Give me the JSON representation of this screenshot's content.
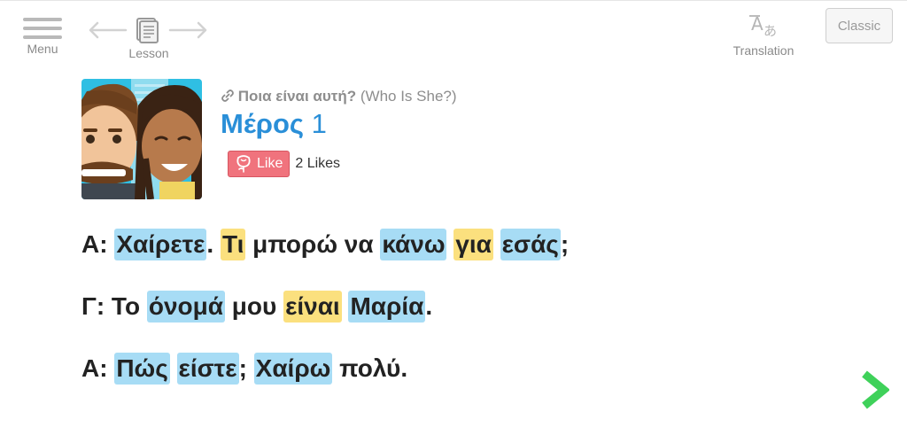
{
  "topbar": {
    "menu_label": "Menu",
    "lesson_label": "Lesson",
    "translation_label": "Translation",
    "classic_label": "Classic"
  },
  "header": {
    "breadcrumb_greek": "Ποια είναι αυτή?",
    "breadcrumb_english": " (Who Is She?)",
    "part_word": "Μέρος",
    "part_number": "1",
    "like_label": "Like",
    "likes_count": "2 Likes"
  },
  "dialogue": {
    "lines": [
      [
        {
          "t": "Α: ",
          "h": ""
        },
        {
          "t": "Χαίρετε",
          "h": "blue"
        },
        {
          "t": ". ",
          "h": ""
        },
        {
          "t": "Τι",
          "h": "yellow"
        },
        {
          "t": " μπορώ να ",
          "h": ""
        },
        {
          "t": "κάνω",
          "h": "blue"
        },
        {
          "t": " ",
          "h": ""
        },
        {
          "t": "για",
          "h": "yellow"
        },
        {
          "t": " ",
          "h": ""
        },
        {
          "t": "εσάς",
          "h": "blue"
        },
        {
          "t": ";",
          "h": ""
        }
      ],
      [
        {
          "t": "Γ: Το ",
          "h": ""
        },
        {
          "t": "όνομά",
          "h": "blue"
        },
        {
          "t": " μου ",
          "h": ""
        },
        {
          "t": "είναι",
          "h": "yellow"
        },
        {
          "t": " ",
          "h": ""
        },
        {
          "t": "Μαρία",
          "h": "blue"
        },
        {
          "t": ".",
          "h": ""
        }
      ],
      [
        {
          "t": "Α: ",
          "h": ""
        },
        {
          "t": "Πώς",
          "h": "blue"
        },
        {
          "t": " ",
          "h": ""
        },
        {
          "t": "είστε",
          "h": "blue"
        },
        {
          "t": "; ",
          "h": ""
        },
        {
          "t": "Χαίρω",
          "h": "blue"
        },
        {
          "t": " πολύ.",
          "h": ""
        }
      ]
    ]
  },
  "colors": {
    "highlight_blue": "#a7dcf5",
    "highlight_yellow": "#fbe07e",
    "title_blue": "#2a8fd8",
    "like_red": "#f0737d",
    "next_green": "#3fd15a"
  },
  "icons": {
    "menu": "hamburger-icon",
    "lesson_prev": "arrow-left-icon",
    "lesson": "document-icon",
    "lesson_next": "arrow-right-icon",
    "translation": "translate-icon",
    "breadcrumb": "link-icon",
    "like": "rose-icon",
    "next": "chevron-right-icon"
  }
}
